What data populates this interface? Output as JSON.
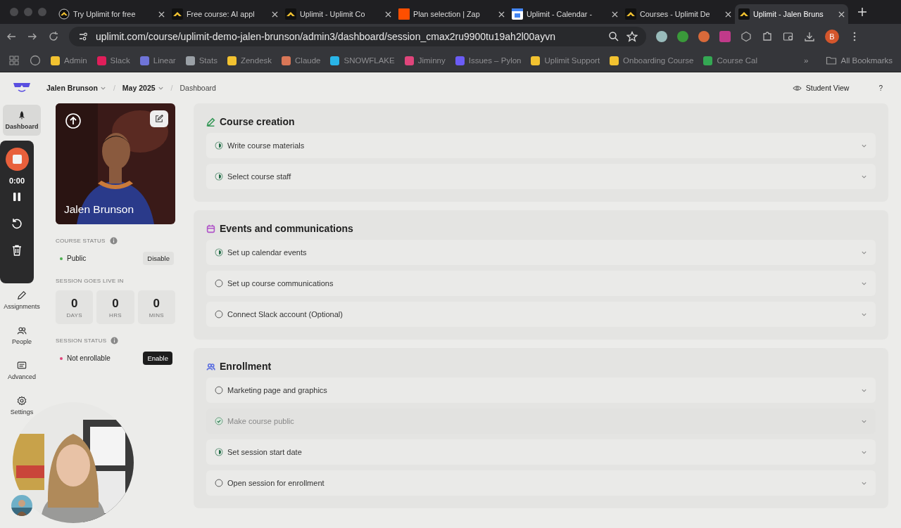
{
  "browser": {
    "tabs": [
      {
        "title": "Try Uplimit for free",
        "kind": "uplimit-ring",
        "selected": false
      },
      {
        "title": "Free course: AI appl",
        "kind": "uplimit",
        "selected": false
      },
      {
        "title": "Uplimit - Uplimit Co",
        "kind": "uplimit",
        "selected": false
      },
      {
        "title": "Plan selection | Zap",
        "kind": "orange",
        "selected": false
      },
      {
        "title": "Uplimit - Calendar -",
        "kind": "calendar",
        "selected": false
      },
      {
        "title": "Courses - Uplimit De",
        "kind": "uplimit",
        "selected": false
      },
      {
        "title": "Uplimit - Jalen Bruns",
        "kind": "uplimit",
        "selected": true
      }
    ],
    "url": "uplimit.com/course/uplimit-demo-jalen-brunson/admin3/dashboard/session_cmax2ru9900tu19ah2l00ayvn",
    "profile_initial": "B",
    "bookmarks": [
      {
        "label": "Admin",
        "color": "#f2c230"
      },
      {
        "label": "Slack",
        "color": "#e01e5a"
      },
      {
        "label": "Linear",
        "color": "#6f74d8"
      },
      {
        "label": "Stats",
        "color": "#9aa0a6"
      },
      {
        "label": "Zendesk",
        "color": "#f2c230"
      },
      {
        "label": "Claude",
        "color": "#d97757"
      },
      {
        "label": "SNOWFLAKE",
        "color": "#29b5e8"
      },
      {
        "label": "Jiminny",
        "color": "#e0457b"
      },
      {
        "label": "Issues – Pylon",
        "color": "#6b5cf6"
      },
      {
        "label": "Uplimit Support",
        "color": "#f2c230"
      },
      {
        "label": "Onboarding Course",
        "color": "#f2c230"
      },
      {
        "label": "Course Cal",
        "color": "#34a853"
      }
    ],
    "more": "»",
    "all_bookmarks": "All Bookmarks"
  },
  "breadcrumb": [
    {
      "label": "Jalen Brunson",
      "dropdown": true
    },
    {
      "separator": "/",
      "label": "May 2025",
      "dropdown": true
    },
    {
      "separator": "/",
      "label": "Dashboard",
      "dropdown": false
    }
  ],
  "student_view": "Student View",
  "help": "?",
  "nav": [
    {
      "label": "Dashboard",
      "kind": "rocket",
      "selected": true
    },
    {
      "label": "Assignments",
      "kind": "pencil",
      "selected": false
    },
    {
      "label": "People",
      "kind": "people",
      "selected": false
    },
    {
      "label": "Advanced",
      "kind": "advanced",
      "selected": false
    },
    {
      "label": "Settings",
      "kind": "gear",
      "selected": false
    }
  ],
  "recorder": {
    "time": "0:00"
  },
  "profile": {
    "name": "Jalen Brunson"
  },
  "course_status": {
    "label": "COURSE STATUS",
    "status": "Public",
    "color": "#4caf50",
    "button": "Disable"
  },
  "countdown": {
    "label": "SESSION GOES LIVE IN",
    "units": [
      {
        "value": "0",
        "unit": "DAYS"
      },
      {
        "value": "0",
        "unit": "HRS"
      },
      {
        "value": "0",
        "unit": "MINS"
      }
    ]
  },
  "session_status": {
    "label": "SESSION STATUS",
    "status": "Not enrollable",
    "color": "#e0457b",
    "button": "Enable"
  },
  "sections": [
    {
      "title": "Course creation",
      "kind": "pencil",
      "color": "#3a9a5b",
      "tasks": [
        {
          "label": "Write course materials",
          "kind": "partial"
        },
        {
          "label": "Select course staff",
          "kind": "partial"
        }
      ]
    },
    {
      "title": "Events and communications",
      "kind": "calendar",
      "color": "#b054c8",
      "tasks": [
        {
          "label": "Set up calendar events",
          "kind": "partial"
        },
        {
          "label": "Set up course communications",
          "kind": "todo"
        },
        {
          "label": "Connect Slack account (Optional)",
          "kind": "todo"
        }
      ]
    },
    {
      "title": "Enrollment",
      "kind": "people",
      "color": "#5b6ee0",
      "tasks": [
        {
          "label": "Marketing page and graphics",
          "kind": "todo"
        },
        {
          "label": "Make course public",
          "kind": "done"
        },
        {
          "label": "Set session start date",
          "kind": "partial"
        },
        {
          "label": "Open session for enrollment",
          "kind": "todo"
        }
      ]
    }
  ]
}
